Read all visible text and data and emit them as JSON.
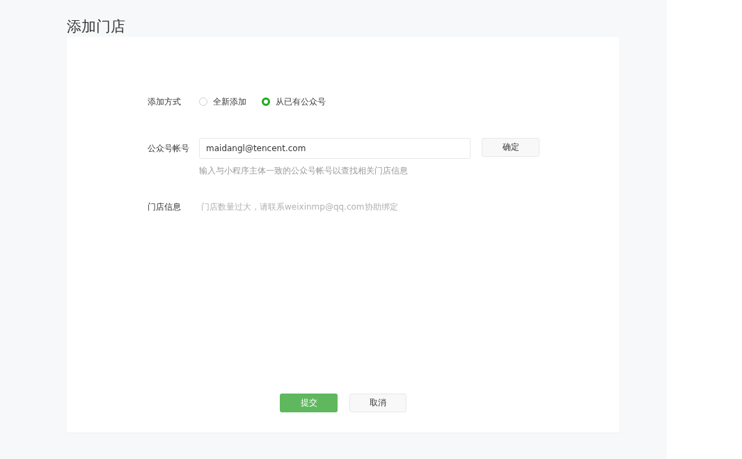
{
  "page_title": "添加门店",
  "add_method": {
    "label": "添加方式",
    "options": [
      {
        "label": "全新添加",
        "selected": false
      },
      {
        "label": "从已有公众号",
        "selected": true
      }
    ]
  },
  "account": {
    "label": "公众号帐号",
    "value": "maidangl@tencent.com",
    "confirm_button": "确定",
    "hint": "输入与小程序主体一致的公众号帐号以查找相关门店信息"
  },
  "store_info": {
    "label": "门店信息",
    "message": "门店数量过大，请联系weixinmp@qq.com协助绑定"
  },
  "submit_button": {
    "label": "提交",
    "disabled": true
  },
  "cancel_button": {
    "label": "取消"
  }
}
